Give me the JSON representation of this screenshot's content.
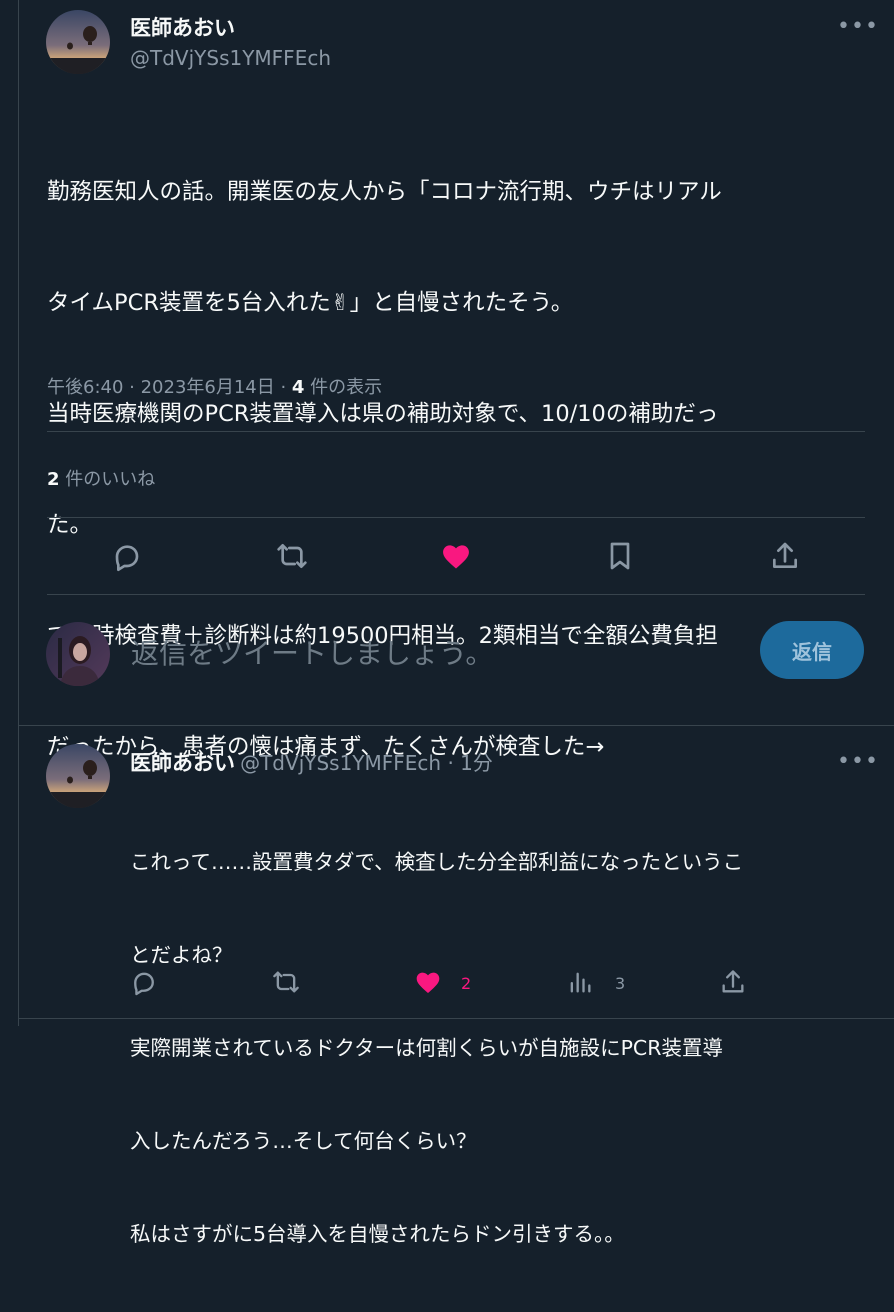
{
  "main_tweet": {
    "author_name": "医師あおい",
    "author_handle": "@TdVjYSs1YMFFEch",
    "more_label": "•••",
    "text_lines": [
      "勤務医知人の話。開業医の友人から「コロナ流行期、ウチはリアル",
      "タイムPCR装置を5台入れた✌」と自慢されたそう。",
      "当時医療機関のPCR装置導入は県の補助対象で、10/10の補助だっ",
      "た。",
      "で当時検査費＋診断料は約19500円相当。2類相当で全額公費負担",
      "だったから、患者の懐は痛まず、たくさんが検査した→"
    ],
    "time": "午後6:40 · 2023年6月14日 · ",
    "views_count": "4",
    "views_label": " 件の表示",
    "likes_count": "2",
    "likes_label": " 件のいいね"
  },
  "actions": {
    "reply_icon": "reply-icon",
    "retweet_icon": "retweet-icon",
    "like_icon": "heart-icon",
    "bookmark_icon": "bookmark-icon",
    "share_icon": "share-icon"
  },
  "composer": {
    "placeholder": "返信をツイートしましょう。",
    "button_label": "返信"
  },
  "reply_tweet": {
    "author_name": "医師あおい",
    "author_handle": "@TdVjYSs1YMFFEch",
    "time": " · 1分",
    "more_label": "•••",
    "text_lines": [
      "これって……設置費タダで、検査した分全部利益になったというこ",
      "とだよね？",
      "実際開業されているドクターは何割くらいが自施設にPCR装置導",
      "入したんだろう…そして何台くらい？",
      "私はさすがに5台導入を自慢されたらドン引きする。。"
    ],
    "like_count": "2",
    "views_count": "3"
  },
  "colors": {
    "background": "#15202b",
    "like_pink": "#f91880",
    "muted": "#8b98a5",
    "button_blue": "#1d6a9c"
  }
}
